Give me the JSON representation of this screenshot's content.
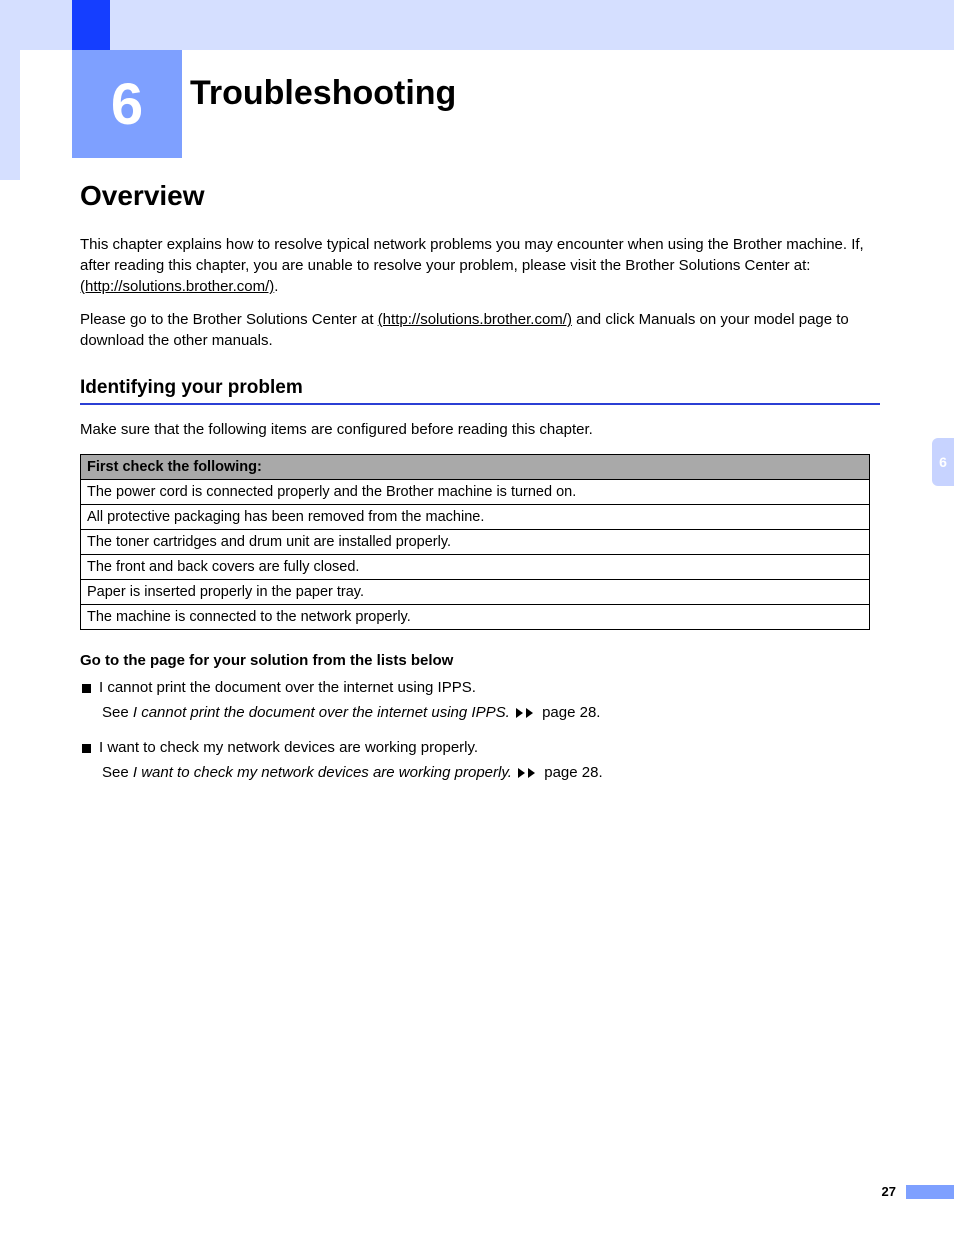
{
  "chapter": {
    "number": "6",
    "title": "Troubleshooting",
    "tab": "6"
  },
  "overview": {
    "heading": "Overview",
    "p1a": "This chapter explains how to resolve typical network problems you may encounter when using the Brother machine. If, after reading this chapter, you are unable to resolve your problem, please visit the Brother Solutions Center at: ",
    "p1link": "(http://solutions.brother.com/)",
    "p1b": ".",
    "p2a": "Please go to the Brother Solutions Center at ",
    "p2link": "(http://solutions.brother.com/)",
    "p2b": " and click Manuals on your model page to download the other manuals."
  },
  "identify": {
    "heading": "Identifying your problem",
    "intro": "Make sure that the following items are configured before reading this chapter.",
    "table_header": "First check the following:",
    "rows": [
      "The power cord is connected properly and the Brother machine is turned on.",
      "All protective packaging has been removed from the machine.",
      "The toner cartridges and drum unit are installed properly.",
      "The front and back covers are fully closed.",
      "Paper is inserted properly in the paper tray.",
      "The machine is connected to the network properly."
    ]
  },
  "golist": {
    "heading": "Go to the page for your solution from the lists below",
    "items": [
      {
        "bullet": "I cannot print the document over the internet using IPPS.",
        "see_pre": "See ",
        "see_ital": "I cannot print the document over the internet using IPPS.",
        "see_post": " page 28."
      },
      {
        "bullet": "I want to check my network devices are working properly.",
        "see_pre": "See ",
        "see_ital": "I want to check my network devices are working properly.",
        "see_post": " page 28."
      }
    ]
  },
  "page_number": "27"
}
